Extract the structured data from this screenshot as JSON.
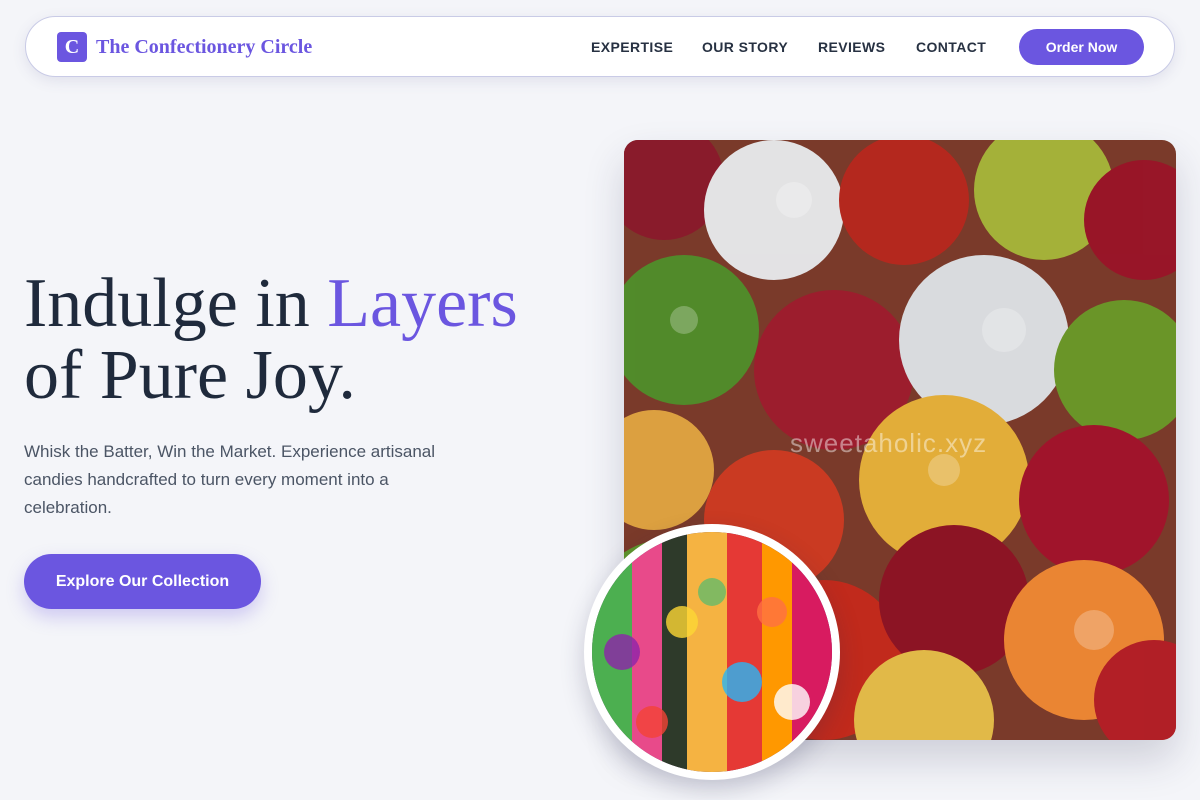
{
  "brand": {
    "logo_letter": "C",
    "name": "The Confectionery Circle"
  },
  "nav": {
    "links": [
      "EXPERTISE",
      "OUR STORY",
      "REVIEWS",
      "CONTACT"
    ],
    "cta_label": "Order Now"
  },
  "hero": {
    "title_part1": "Indulge in ",
    "title_accent": "Layers",
    "title_part2": "of Pure Joy.",
    "description": "Whisk the Batter, Win the Market. Experience artisanal candies handcrafted to turn every moment into a celebration.",
    "cta_label": "Explore Our Collection"
  },
  "images": {
    "main": "gummy-bears-photo",
    "watermark": "sweetaholic.xyz",
    "inset": "candy-assortment-photo"
  },
  "colors": {
    "accent": "#6b56e0",
    "background": "#f4f5f9",
    "heading": "#1f2a3c"
  }
}
